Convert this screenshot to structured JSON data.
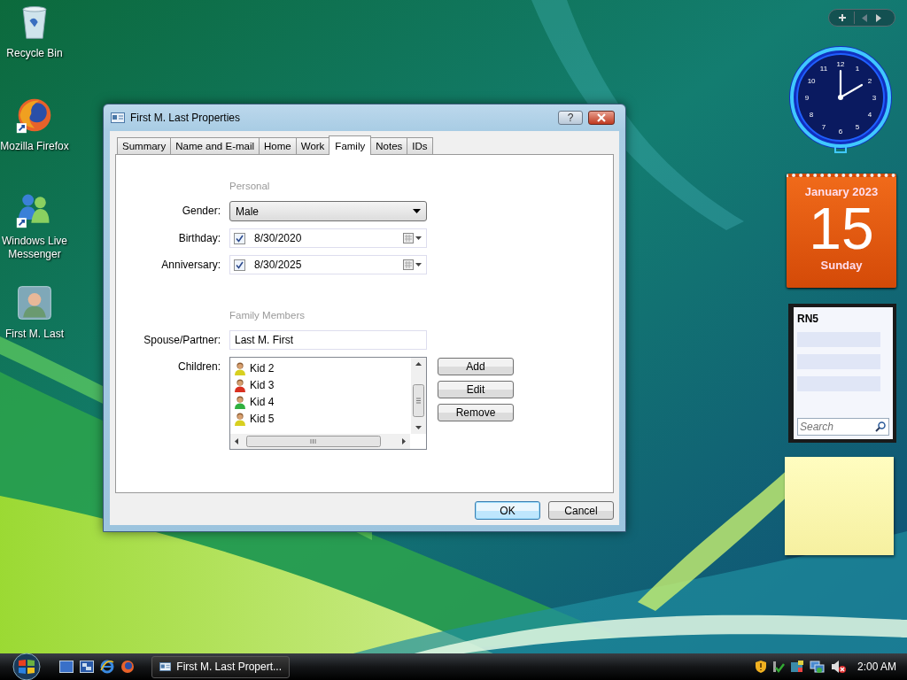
{
  "desktop_icons": [
    {
      "label": "Recycle Bin",
      "kind": "recycle"
    },
    {
      "label": "Mozilla Firefox",
      "kind": "firefox"
    },
    {
      "label": "Windows Live Messenger",
      "kind": "messenger"
    },
    {
      "label": "First M. Last",
      "kind": "contact"
    }
  ],
  "dialog": {
    "title": "First M. Last Properties",
    "help": "?",
    "tabs": [
      {
        "label": "Summary",
        "selected": false
      },
      {
        "label": "Name and E-mail",
        "selected": false
      },
      {
        "label": "Home",
        "selected": false
      },
      {
        "label": "Work",
        "selected": false
      },
      {
        "label": "Family",
        "selected": true
      },
      {
        "label": "Notes",
        "selected": false
      },
      {
        "label": "IDs",
        "selected": false
      }
    ],
    "personal": {
      "heading": "Personal",
      "gender": {
        "label": "Gender:",
        "value": "Male"
      },
      "birthday": {
        "label": "Birthday:",
        "value": "8/30/2020",
        "checked": true
      },
      "anniversary": {
        "label": "Anniversary:",
        "value": "8/30/2025",
        "checked": true
      }
    },
    "family": {
      "heading": "Family Members",
      "spouse": {
        "label": "Spouse/Partner:",
        "value": "Last M. First"
      },
      "children": {
        "label": "Children:",
        "items": [
          {
            "name": "Kid 2",
            "color": "#d8d020"
          },
          {
            "name": "Kid 3",
            "color": "#d83020"
          },
          {
            "name": "Kid 4",
            "color": "#30b040"
          },
          {
            "name": "Kid 5",
            "color": "#d8d020"
          }
        ]
      },
      "buttons": [
        "Add",
        "Edit",
        "Remove"
      ]
    },
    "footer_buttons": [
      {
        "label": "OK",
        "default": true
      },
      {
        "label": "Cancel",
        "default": false
      }
    ]
  },
  "sidebar": {
    "clock": {
      "numerals": [
        "12",
        "1",
        "2",
        "3",
        "4",
        "5",
        "6",
        "7",
        "8",
        "9",
        "10",
        "11"
      ]
    },
    "calendar": {
      "month": "January 2023",
      "day": "15",
      "weekday": "Sunday"
    },
    "contacts": {
      "title": "RN5",
      "search_placeholder": "Search"
    },
    "note": {
      "kind": "sticky"
    }
  },
  "taskbar": {
    "task": "First M. Last Propert...",
    "time": "2:00 AM"
  }
}
